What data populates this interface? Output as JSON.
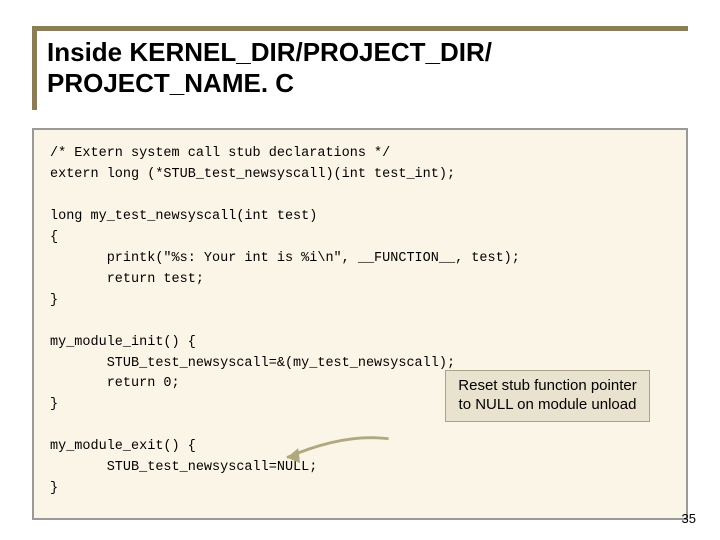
{
  "title_line1": "Inside KERNEL_DIR/PROJECT_DIR/",
  "title_line2": "PROJECT_NAME. C",
  "code": "/* Extern system call stub declarations */\nextern long (*STUB_test_newsyscall)(int test_int);\n\nlong my_test_newsyscall(int test)\n{\n       printk(\"%s: Your int is %i\\n\", __FUNCTION__, test);\n       return test;\n}\n\nmy_module_init() {\n       STUB_test_newsyscall=&(my_test_newsyscall);\n       return 0;\n}\n\nmy_module_exit() {\n       STUB_test_newsyscall=NULL;\n}",
  "callout_text": "Reset stub function pointer to NULL on module unload",
  "page_number": "35"
}
